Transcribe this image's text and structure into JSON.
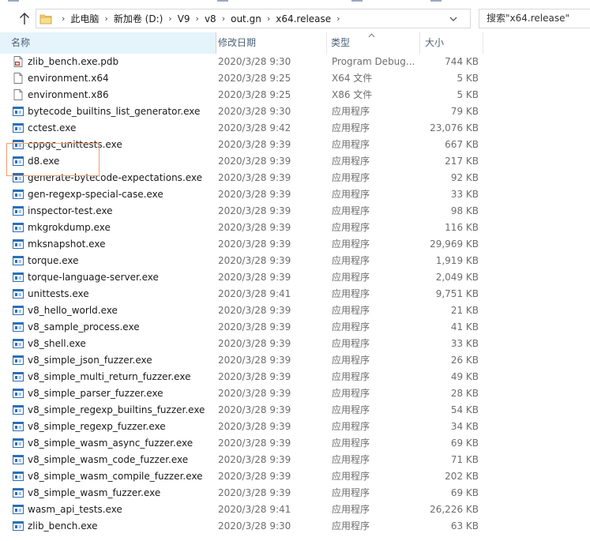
{
  "address": {
    "path": [
      "此电脑",
      "新加卷 (D:)",
      "V9",
      "v8",
      "out.gn",
      "x64.release"
    ]
  },
  "search": {
    "placeholder": "搜索\"x64.release\""
  },
  "columns": {
    "name": "名称",
    "date": "修改日期",
    "type": "类型",
    "size": "大小"
  },
  "files": [
    {
      "name": "zlib_bench.exe.pdb",
      "date": "2020/3/28 9:30",
      "type": "Program Debug...",
      "size": "744 KB",
      "icon": "pdb-file-icon"
    },
    {
      "name": "environment.x64",
      "date": "2020/3/28 9:25",
      "type": "X64 文件",
      "size": "5 KB",
      "icon": "blank-file-icon"
    },
    {
      "name": "environment.x86",
      "date": "2020/3/28 9:25",
      "type": "X86 文件",
      "size": "5 KB",
      "icon": "blank-file-icon"
    },
    {
      "name": "bytecode_builtins_list_generator.exe",
      "date": "2020/3/28 9:30",
      "type": "应用程序",
      "size": "79 KB",
      "icon": "exe-icon"
    },
    {
      "name": "cctest.exe",
      "date": "2020/3/28 9:42",
      "type": "应用程序",
      "size": "23,076 KB",
      "icon": "exe-icon"
    },
    {
      "name": "cppgc_unittests.exe",
      "date": "2020/3/28 9:39",
      "type": "应用程序",
      "size": "667 KB",
      "icon": "exe-icon"
    },
    {
      "name": "d8.exe",
      "date": "2020/3/28 9:39",
      "type": "应用程序",
      "size": "217 KB",
      "icon": "exe-icon"
    },
    {
      "name": "generate-bytecode-expectations.exe",
      "date": "2020/3/28 9:39",
      "type": "应用程序",
      "size": "92 KB",
      "icon": "exe-icon"
    },
    {
      "name": "gen-regexp-special-case.exe",
      "date": "2020/3/28 9:39",
      "type": "应用程序",
      "size": "33 KB",
      "icon": "exe-icon"
    },
    {
      "name": "inspector-test.exe",
      "date": "2020/3/28 9:39",
      "type": "应用程序",
      "size": "98 KB",
      "icon": "exe-icon"
    },
    {
      "name": "mkgrokdump.exe",
      "date": "2020/3/28 9:39",
      "type": "应用程序",
      "size": "116 KB",
      "icon": "exe-icon"
    },
    {
      "name": "mksnapshot.exe",
      "date": "2020/3/28 9:39",
      "type": "应用程序",
      "size": "29,969 KB",
      "icon": "exe-icon"
    },
    {
      "name": "torque.exe",
      "date": "2020/3/28 9:39",
      "type": "应用程序",
      "size": "1,919 KB",
      "icon": "exe-icon"
    },
    {
      "name": "torque-language-server.exe",
      "date": "2020/3/28 9:39",
      "type": "应用程序",
      "size": "2,049 KB",
      "icon": "exe-icon"
    },
    {
      "name": "unittests.exe",
      "date": "2020/3/28 9:41",
      "type": "应用程序",
      "size": "9,751 KB",
      "icon": "exe-icon"
    },
    {
      "name": "v8_hello_world.exe",
      "date": "2020/3/28 9:39",
      "type": "应用程序",
      "size": "21 KB",
      "icon": "exe-icon"
    },
    {
      "name": "v8_sample_process.exe",
      "date": "2020/3/28 9:39",
      "type": "应用程序",
      "size": "41 KB",
      "icon": "exe-icon"
    },
    {
      "name": "v8_shell.exe",
      "date": "2020/3/28 9:39",
      "type": "应用程序",
      "size": "33 KB",
      "icon": "exe-icon"
    },
    {
      "name": "v8_simple_json_fuzzer.exe",
      "date": "2020/3/28 9:39",
      "type": "应用程序",
      "size": "26 KB",
      "icon": "exe-icon"
    },
    {
      "name": "v8_simple_multi_return_fuzzer.exe",
      "date": "2020/3/28 9:39",
      "type": "应用程序",
      "size": "49 KB",
      "icon": "exe-icon"
    },
    {
      "name": "v8_simple_parser_fuzzer.exe",
      "date": "2020/3/28 9:39",
      "type": "应用程序",
      "size": "28 KB",
      "icon": "exe-icon"
    },
    {
      "name": "v8_simple_regexp_builtins_fuzzer.exe",
      "date": "2020/3/28 9:39",
      "type": "应用程序",
      "size": "54 KB",
      "icon": "exe-icon"
    },
    {
      "name": "v8_simple_regexp_fuzzer.exe",
      "date": "2020/3/28 9:39",
      "type": "应用程序",
      "size": "34 KB",
      "icon": "exe-icon"
    },
    {
      "name": "v8_simple_wasm_async_fuzzer.exe",
      "date": "2020/3/28 9:39",
      "type": "应用程序",
      "size": "69 KB",
      "icon": "exe-icon"
    },
    {
      "name": "v8_simple_wasm_code_fuzzer.exe",
      "date": "2020/3/28 9:39",
      "type": "应用程序",
      "size": "71 KB",
      "icon": "exe-icon"
    },
    {
      "name": "v8_simple_wasm_compile_fuzzer.exe",
      "date": "2020/3/28 9:39",
      "type": "应用程序",
      "size": "202 KB",
      "icon": "exe-icon"
    },
    {
      "name": "v8_simple_wasm_fuzzer.exe",
      "date": "2020/3/28 9:39",
      "type": "应用程序",
      "size": "69 KB",
      "icon": "exe-icon"
    },
    {
      "name": "wasm_api_tests.exe",
      "date": "2020/3/28 9:41",
      "type": "应用程序",
      "size": "26,226 KB",
      "icon": "exe-icon"
    },
    {
      "name": "zlib_bench.exe",
      "date": "2020/3/28 9:30",
      "type": "应用程序",
      "size": "63 KB",
      "icon": "exe-icon"
    }
  ],
  "colors": {
    "header_text": "#4c607a",
    "header_highlight": "#e5f3fb",
    "detail_text": "#6d6d6d",
    "highlight_border": "#f0a070"
  }
}
